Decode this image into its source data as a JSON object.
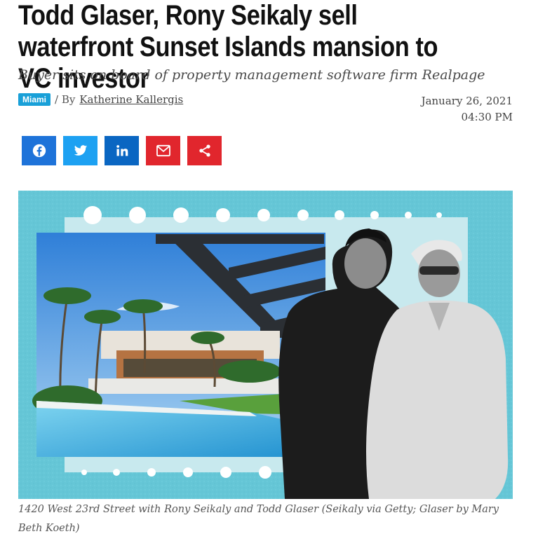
{
  "article": {
    "headline": "Todd Glaser, Rony Seikaly sell waterfront Sunset Islands mansion to VC investor",
    "subheadline": "Buyer sits on board of property management software firm Realpage",
    "tag": "Miami",
    "byline_prefix": "/ By",
    "author": "Katherine Kallergis",
    "date": "January 26, 2021",
    "time": "04:30 PM",
    "caption": "1420 West 23rd Street with Rony Seikaly and Todd Glaser (Seikaly via Getty; Glaser by Mary Beth Koeth)"
  },
  "share": {
    "buttons": [
      {
        "icon": "facebook-icon",
        "color": "#1e73d9"
      },
      {
        "icon": "twitter-icon",
        "color": "#1da1f2"
      },
      {
        "icon": "linkedin-icon",
        "color": "#0a66c2"
      },
      {
        "icon": "email-icon",
        "color": "#e1262d"
      },
      {
        "icon": "share-icon",
        "color": "#e1262d"
      }
    ]
  },
  "colors": {
    "tag_bg": "#19a0d8",
    "hero_bg": "#65c6d6"
  }
}
